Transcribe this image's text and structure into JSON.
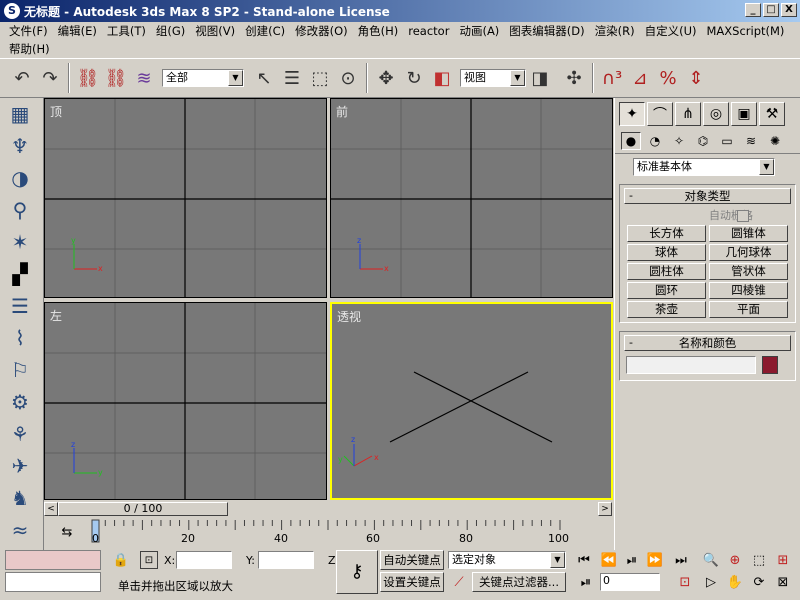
{
  "title": "无标题 - Autodesk 3ds Max 8 SP2  - Stand-alone License",
  "window_buttons": [
    "_",
    "□",
    "X"
  ],
  "menu": [
    "文件(F)",
    "编辑(E)",
    "工具(T)",
    "组(G)",
    "视图(V)",
    "创建(C)",
    "修改器(O)",
    "角色(H)",
    "reactor",
    "动画(A)",
    "图表编辑器(D)",
    "渲染(R)",
    "自定义(U)",
    "MAXScript(M)",
    "帮助(H)"
  ],
  "toolbar": {
    "selection_filter": "全部",
    "ref_coord": "视图"
  },
  "viewports": {
    "top": "顶",
    "front": "前",
    "left": "左",
    "perspective": "透视"
  },
  "command_panel": {
    "category": "标准基本体",
    "object_type_header": "对象类型",
    "autogrid_label": "自动栅格",
    "buttons": [
      "长方体",
      "圆锥体",
      "球体",
      "几何球体",
      "圆柱体",
      "管状体",
      "圆环",
      "四棱锥",
      "茶壶",
      "平面"
    ],
    "name_color_header": "名称和颜色",
    "name_value": "",
    "object_color": "#8b1a2e"
  },
  "timeline": {
    "frame_display": "0 / 100",
    "current_frame": 0,
    "total_frames": 100,
    "ticks": [
      "0",
      "20",
      "40",
      "60",
      "80",
      "100"
    ]
  },
  "status": {
    "prompt": "单击并拖出区域以放大",
    "x_label": "X:",
    "y_label": "Y:",
    "z_label": "Z",
    "x_value": "",
    "y_value": "",
    "auto_key": "自动关键点",
    "set_key": "设置关键点",
    "key_mode_value": "选定对象",
    "key_filter": "关键点过滤器...",
    "frame_value": "0"
  }
}
